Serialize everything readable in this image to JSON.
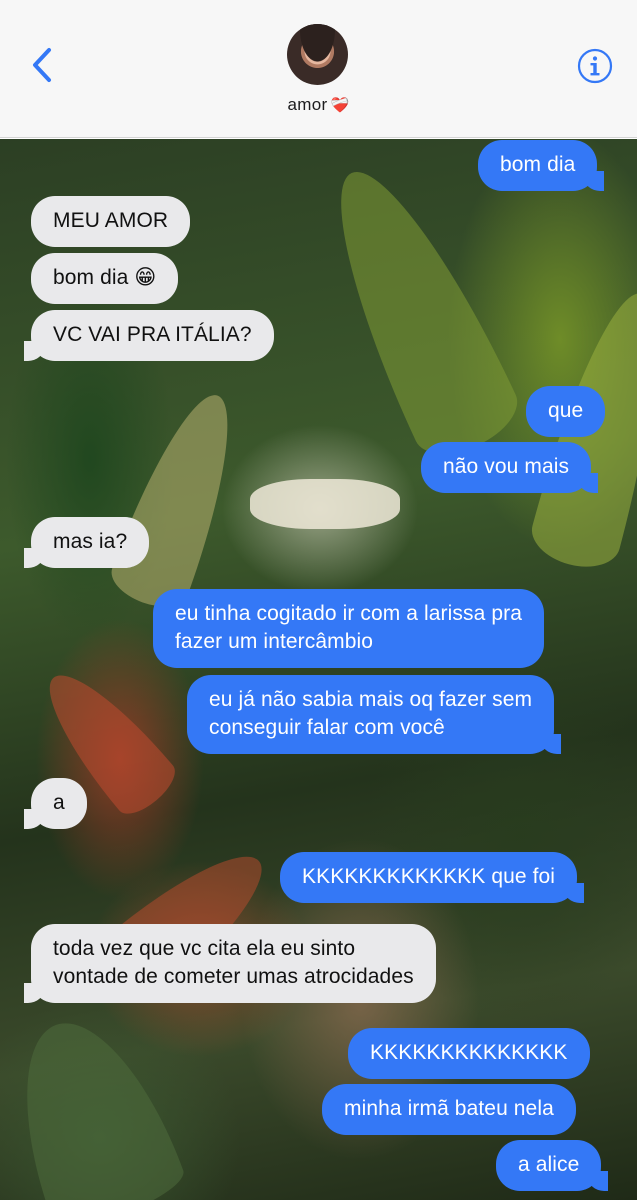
{
  "header": {
    "contact_name": "amor",
    "contact_emoji": "❤️‍🩹"
  },
  "colors": {
    "accent": "#3478f6",
    "outgoing_bubble": "#3478f6",
    "incoming_bubble": "#e9e9eb",
    "header_bg": "#f7f7f7"
  },
  "icons": {
    "back": "chevron-left-icon",
    "info": "info-circle-icon"
  },
  "messages": [
    {
      "direction": "out",
      "text": "bom dia"
    },
    {
      "direction": "in",
      "text": "MEU AMOR"
    },
    {
      "direction": "in",
      "text": "bom dia 😁"
    },
    {
      "direction": "in",
      "text": "VC VAI PRA ITÁLIA?"
    },
    {
      "direction": "out",
      "text": "que"
    },
    {
      "direction": "out",
      "text": "não vou mais"
    },
    {
      "direction": "in",
      "text": "mas ia?"
    },
    {
      "direction": "out",
      "text": "eu tinha cogitado ir com a larissa pra\nfazer um intercâmbio"
    },
    {
      "direction": "out",
      "text": "eu já não sabia mais oq fazer sem\nconseguir falar com você"
    },
    {
      "direction": "in",
      "text": "a"
    },
    {
      "direction": "out",
      "text": "KKKKKKKKKKKKK que foi"
    },
    {
      "direction": "in",
      "text": "toda vez que vc cita ela eu sinto\nvontade de cometer umas atrocidades"
    },
    {
      "direction": "out",
      "text": "KKKKKKKKKKKKKK"
    },
    {
      "direction": "out",
      "text": "minha irmã bateu nela"
    },
    {
      "direction": "out",
      "text": "a alice"
    }
  ]
}
